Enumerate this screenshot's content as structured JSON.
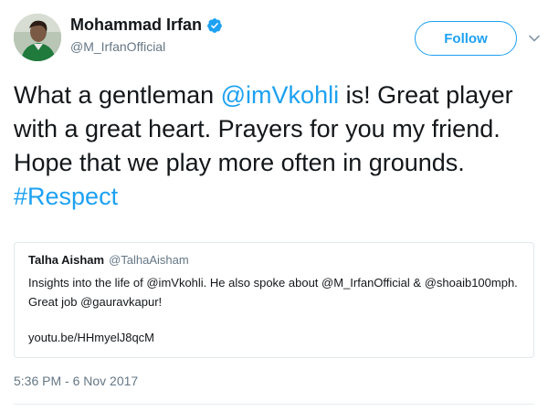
{
  "author": {
    "display_name": "Mohammad Irfan",
    "handle": "@M_IrfanOfficial",
    "verified": true,
    "avatar_icon": "profile-photo"
  },
  "follow_label": "Follow",
  "menu_icon": "chevron-down-icon",
  "tweet": {
    "segments": [
      {
        "text": "What a gentleman ",
        "type": "text"
      },
      {
        "text": "@imVkohli",
        "type": "mention"
      },
      {
        "text": " is! Great player with a great heart. Prayers for you my friend. Hope that we play more often in grounds. ",
        "type": "text"
      },
      {
        "text": "#Respect",
        "type": "hashtag"
      }
    ]
  },
  "quoted": {
    "name": "Talha Aisham",
    "handle": "@TalhaAisham",
    "text": "Insights into the life of @imVkohli. He also spoke about @M_IrfanOfficial & @shoaib100mph. Great job @gauravkapur!",
    "link": "youtu.be/HHmyelJ8qcM"
  },
  "timestamp": "5:36 PM - 6 Nov 2017",
  "colors": {
    "accent": "#1da1f2",
    "text": "#14171a",
    "muted": "#657786",
    "border": "#e1e8ed"
  }
}
